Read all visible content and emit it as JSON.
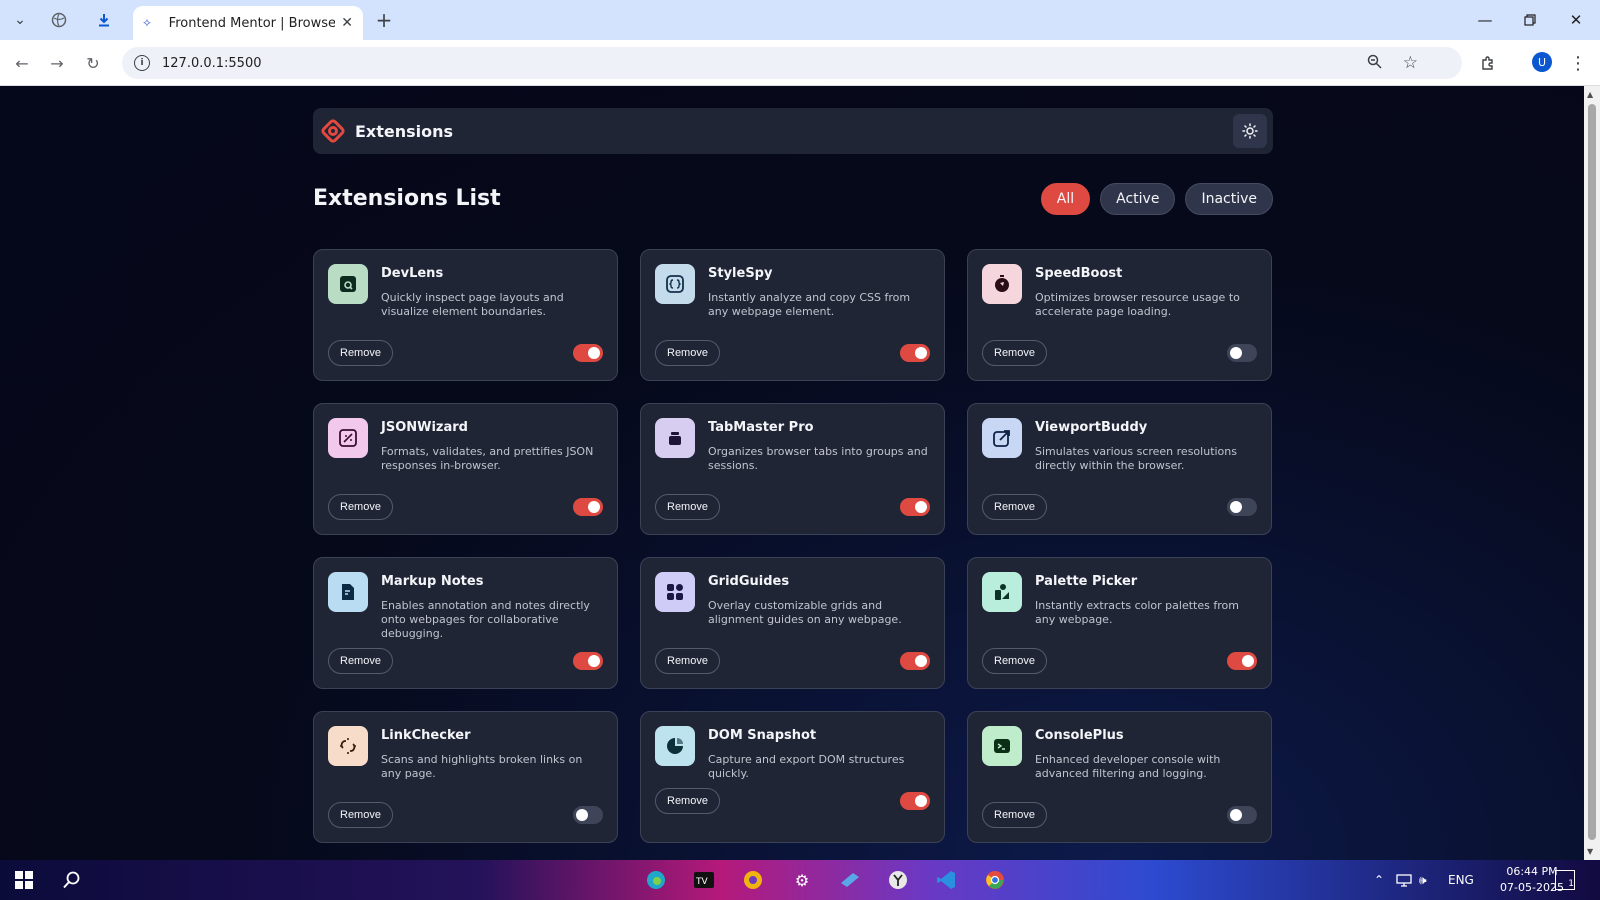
{
  "browser": {
    "tab_title": "Frontend Mentor | Browser exte",
    "url": "127.0.0.1:5500",
    "profile_initial": "U"
  },
  "header": {
    "logo_text": "Extensions"
  },
  "list": {
    "title": "Extensions List",
    "filters": [
      {
        "label": "All",
        "active": true
      },
      {
        "label": "Active",
        "active": false
      },
      {
        "label": "Inactive",
        "active": false
      }
    ],
    "remove_label": "Remove"
  },
  "extensions": [
    {
      "name": "DevLens",
      "description": "Quickly inspect page layouts and visualize element boundaries.",
      "enabled": true,
      "icon": "devlens-icon",
      "icon_bg": "#b9dcc4"
    },
    {
      "name": "StyleSpy",
      "description": "Instantly analyze and copy CSS from any webpage element.",
      "enabled": true,
      "icon": "stylespy-icon",
      "icon_bg": "#c3dbea"
    },
    {
      "name": "SpeedBoost",
      "description": "Optimizes browser resource usage to accelerate page loading.",
      "enabled": false,
      "icon": "speedboost-icon",
      "icon_bg": "#f5d6dc"
    },
    {
      "name": "JSONWizard",
      "description": "Formats, validates, and prettifies JSON responses in-browser.",
      "enabled": true,
      "icon": "jsonwizard-icon",
      "icon_bg": "#f2c9ec"
    },
    {
      "name": "TabMaster Pro",
      "description": "Organizes browser tabs into groups and sessions.",
      "enabled": true,
      "icon": "tabmaster-icon",
      "icon_bg": "#d7cdf1"
    },
    {
      "name": "ViewportBuddy",
      "description": "Simulates various screen resolutions directly within the browser.",
      "enabled": false,
      "icon": "viewportbuddy-icon",
      "icon_bg": "#c7d7f4"
    },
    {
      "name": "Markup Notes",
      "description": "Enables annotation and notes directly onto webpages for collaborative debugging.",
      "enabled": true,
      "icon": "markupnotes-icon",
      "icon_bg": "#b9dcf3"
    },
    {
      "name": "GridGuides",
      "description": "Overlay customizable grids and alignment guides on any webpage.",
      "enabled": true,
      "icon": "gridguides-icon",
      "icon_bg": "#cfcdf7"
    },
    {
      "name": "Palette Picker",
      "description": "Instantly extracts color palettes from any webpage.",
      "enabled": true,
      "icon": "palettepicker-icon",
      "icon_bg": "#b9eddc"
    },
    {
      "name": "LinkChecker",
      "description": "Scans and highlights broken links on any page.",
      "enabled": false,
      "icon": "linkchecker-icon",
      "icon_bg": "#f7dcc9"
    },
    {
      "name": "DOM Snapshot",
      "description": "Capture and export DOM structures quickly.",
      "enabled": true,
      "icon": "domsnapshot-icon",
      "icon_bg": "#bde3ef"
    },
    {
      "name": "ConsolePlus",
      "description": "Enhanced developer console with advanced filtering and logging.",
      "enabled": false,
      "icon": "consoleplus-icon",
      "icon_bg": "#bfeccb"
    }
  ],
  "taskbar": {
    "language": "ENG",
    "time": "06:44 PM",
    "date": "07-05-2025",
    "notification_count": "1"
  },
  "colors": {
    "accent": "#de4a42",
    "card_bg": "#202535",
    "page_bg": "#06091a"
  }
}
